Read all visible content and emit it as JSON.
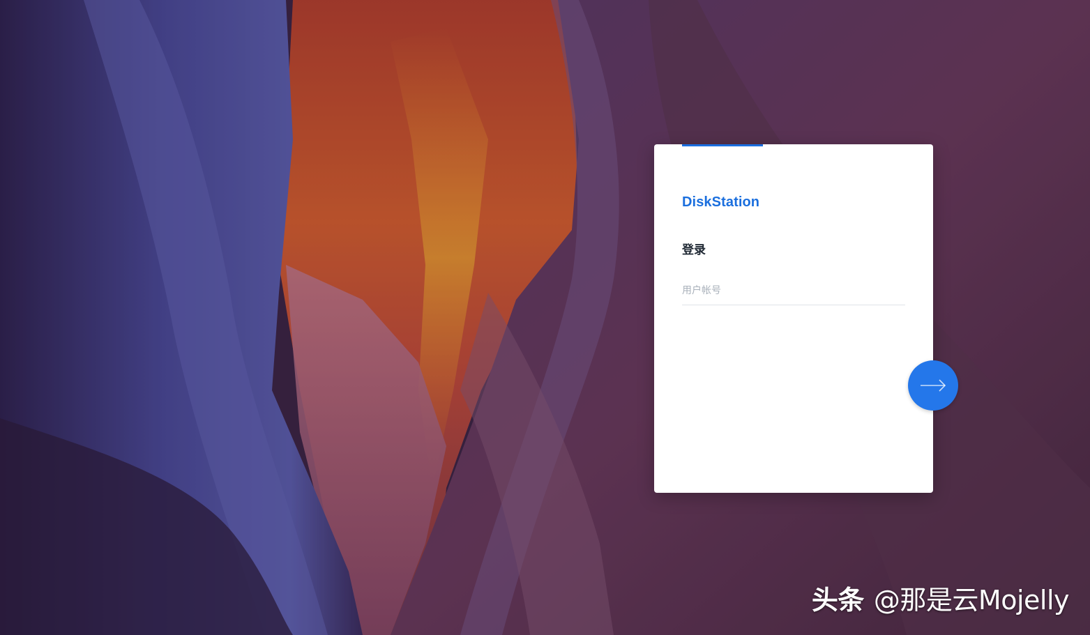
{
  "login": {
    "brand": "DiskStation",
    "title": "登录",
    "username_placeholder": "用户帐号",
    "username_value": ""
  },
  "watermark": {
    "logo": "头条",
    "handle": "@那是云Mojelly"
  },
  "colors": {
    "accent": "#2477ea",
    "brand_text": "#1b6fde",
    "card_bg": "#ffffff"
  },
  "icons": {
    "next": "arrow-right-icon"
  }
}
